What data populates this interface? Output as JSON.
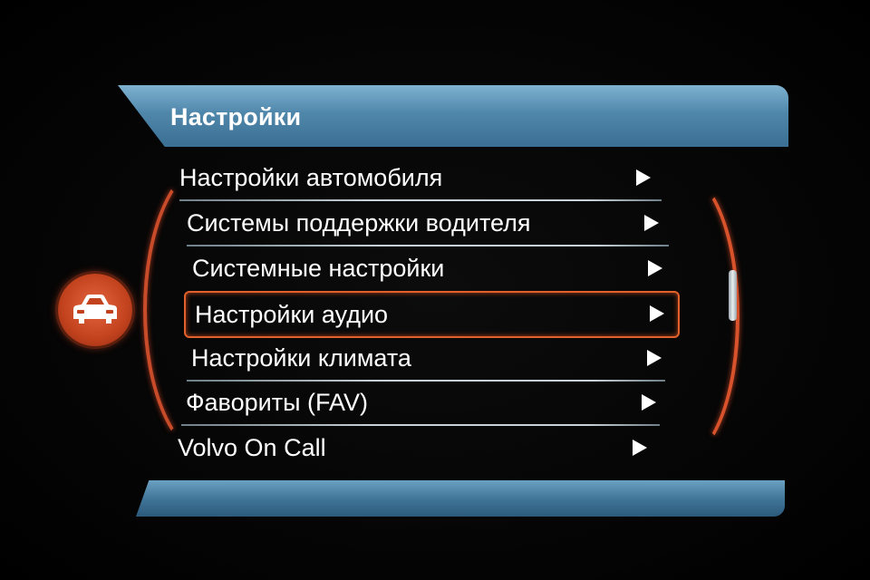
{
  "header": {
    "title": "Настройки"
  },
  "menu": {
    "items": [
      {
        "label": "Настройки автомобиля"
      },
      {
        "label": "Системы поддержки водителя"
      },
      {
        "label": "Системные настройки"
      },
      {
        "label": "Настройки аудио",
        "selected": true
      },
      {
        "label": "Настройки климата"
      },
      {
        "label": "Фавориты (FAV)"
      },
      {
        "label": "Volvo On Call"
      }
    ]
  },
  "icons": {
    "side_badge": "car-icon",
    "item_arrow": "triangle-right-icon"
  },
  "colors": {
    "header_blue": "#4f87ab",
    "accent_orange": "#e2612a",
    "text": "#ffffff"
  }
}
